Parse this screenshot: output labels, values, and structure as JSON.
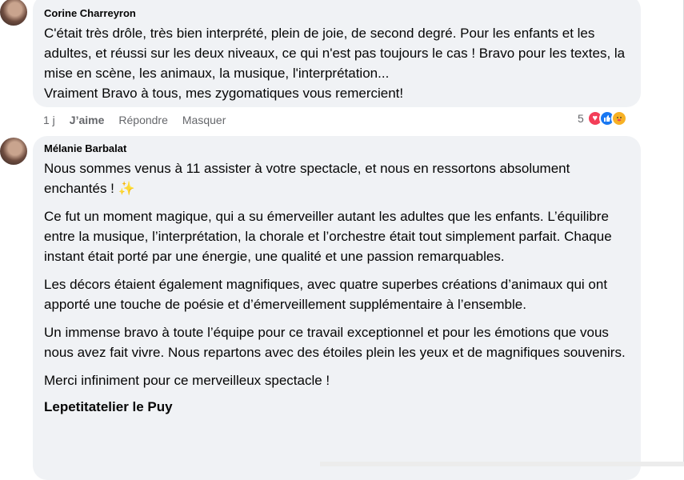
{
  "comments": [
    {
      "author": "Corine Charreyron",
      "paragraphs": [
        "C'était très drôle, très bien interprété, plein de joie, de second degré. Pour les enfants et les adultes, et réussi sur les deux niveaux, ce qui n'est pas toujours le cas ! Bravo pour les textes, la mise en scène, les animaux, la musique, l'interprétation...",
        "Vraiment Bravo à tous, mes zygomatiques vous remercient!"
      ],
      "time": "1 j",
      "like_label": "J’aime",
      "reply_label": "Répondre",
      "hide_label": "Masquer",
      "reaction_count": "5",
      "reactions": [
        "heart-icon",
        "like-icon",
        "care-icon"
      ]
    },
    {
      "author": "Mélanie Barbalat",
      "paragraphs": [
        "Nous sommes venus à 11 assister à votre spectacle, et nous en ressortons absolument enchantés ! ✨",
        "Ce fut un moment magique, qui a su émerveiller autant les adultes que les enfants. L’équilibre entre la musique, l’interprétation, la chorale et l’orchestre était tout simplement parfait. Chaque instant était porté par une énergie, une qualité et une passion remarquables.",
        "Les décors étaient également magnifiques, avec quatre superbes créations d’animaux qui ont apporté une touche de poésie et d’émerveillement supplémentaire à l’ensemble.",
        "Un immense bravo à toute l’équipe pour ce travail exceptionnel et pour les émotions que vous nous avez fait vivre. Nous repartons avec des étoiles plein les yeux et de magnifiques souvenirs.",
        "Merci infiniment pour ce merveilleux spectacle !"
      ],
      "mention": "Lepetitatelier le Puy"
    }
  ],
  "colors": {
    "bubble": "#f0f2f5",
    "secondary_text": "#65676b",
    "love": "#f33e58",
    "like": "#1877f2",
    "care": "#f7b125"
  }
}
